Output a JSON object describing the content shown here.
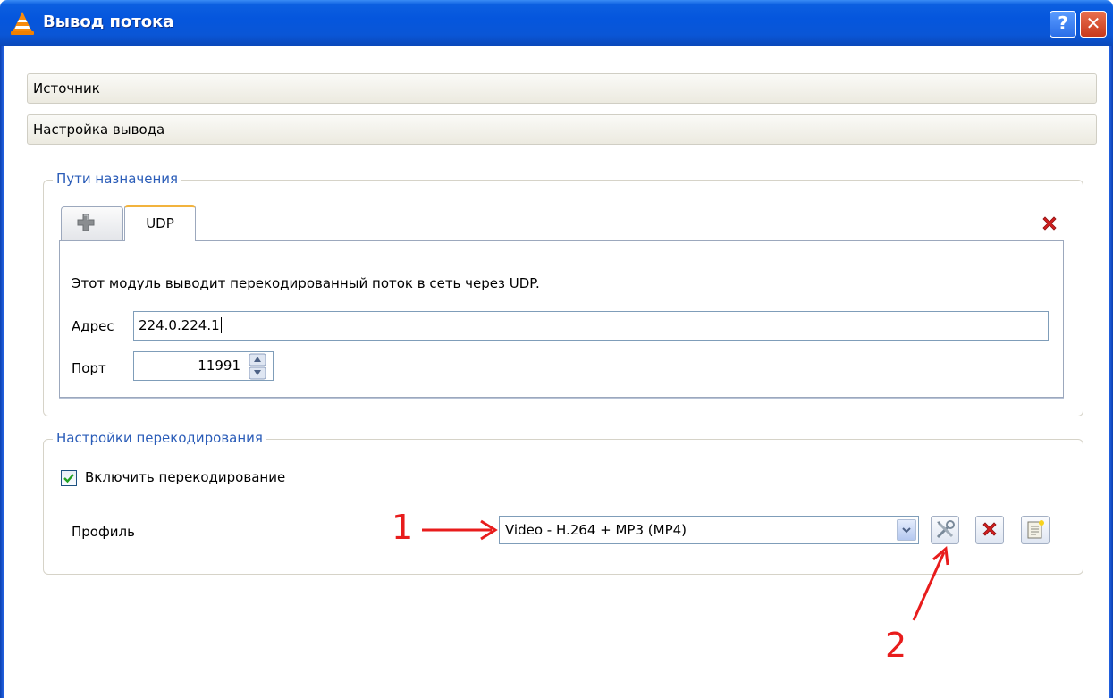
{
  "window": {
    "title": "Вывод потока",
    "help_button": "?",
    "close_button": "✕"
  },
  "sections": {
    "source": "Источник",
    "output_settings": "Настройка вывода"
  },
  "destinations": {
    "legend": "Пути назначения",
    "tabs": [
      {
        "label": "+",
        "icon": "plus-icon"
      },
      {
        "label": "UDP",
        "selected": true
      }
    ],
    "description": "Этот модуль выводит перекодированный поток в сеть через UDP.",
    "address_label": "Адрес",
    "address_value": "224.0.224.1",
    "port_label": "Порт",
    "port_value": "11991"
  },
  "transcoding": {
    "legend": "Настройки перекодирования",
    "enable_label": "Включить перекодирование",
    "enabled": true,
    "profile_label": "Профиль",
    "profile_value": "Video - H.264 + MP3 (MP4)",
    "buttons": [
      "edit-profile",
      "delete-profile",
      "new-profile"
    ]
  },
  "annotations": {
    "one": "1",
    "two": "2",
    "color": "#e81c1c"
  },
  "colors": {
    "titlebar": "#0556dd",
    "legend_text": "#2a5cb8",
    "tab_accent": "#f2b33d",
    "delete_red": "#d21f1f"
  }
}
